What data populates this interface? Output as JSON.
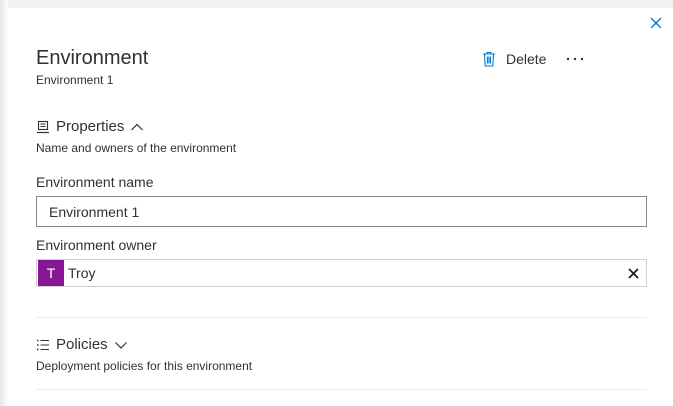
{
  "panel": {
    "title": "Environment",
    "subtitle": "Environment 1",
    "close_icon": "close-icon",
    "delete_label": "Delete",
    "more_label": "···"
  },
  "properties": {
    "heading": "Properties",
    "description": "Name and owners of the environment",
    "name_label": "Environment name",
    "name_value": "Environment 1",
    "owner_label": "Environment owner",
    "owner_initial": "T",
    "owner_name": "Troy",
    "owner_color": "#881798"
  },
  "policies": {
    "heading": "Policies",
    "description": "Deployment policies for this environment"
  }
}
